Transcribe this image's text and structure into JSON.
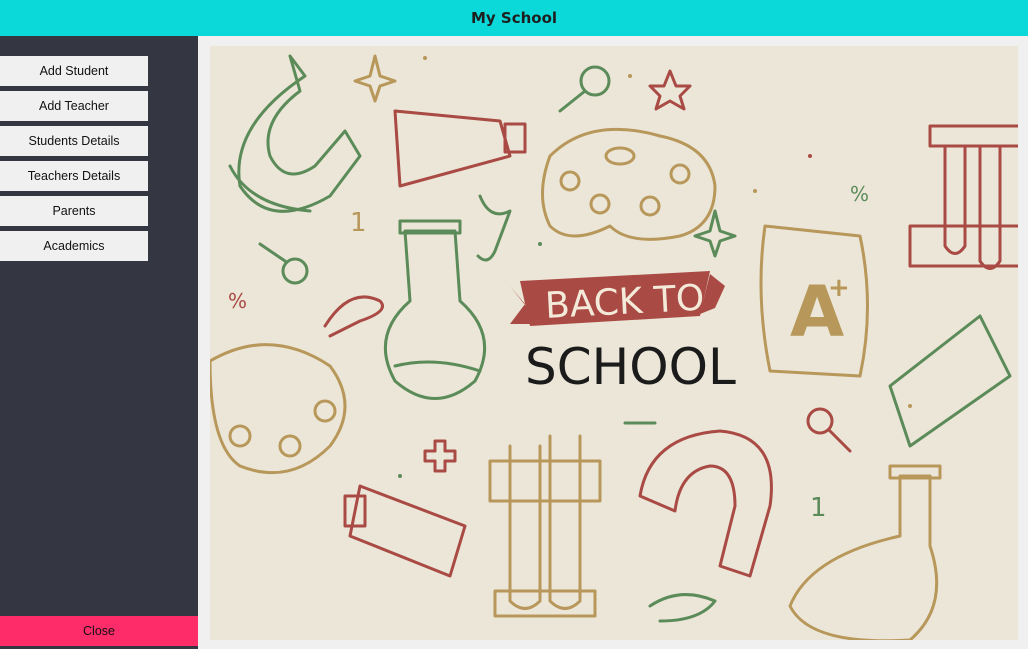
{
  "window": {
    "title": "My School"
  },
  "sidebar": {
    "items": [
      {
        "label": "Add Student"
      },
      {
        "label": "Add Teacher"
      },
      {
        "label": "Students Details"
      },
      {
        "label": "Teachers Details"
      },
      {
        "label": "Parents"
      },
      {
        "label": "Academics"
      }
    ],
    "close_label": "Close"
  },
  "banner": {
    "line1": "BACK TO",
    "line2": "SCHOOL"
  },
  "colors": {
    "titlebar": "#0bd8d8",
    "sidebar": "#343741",
    "close_button": "#ff2c6a",
    "banner_background": "#ebe6d7"
  }
}
